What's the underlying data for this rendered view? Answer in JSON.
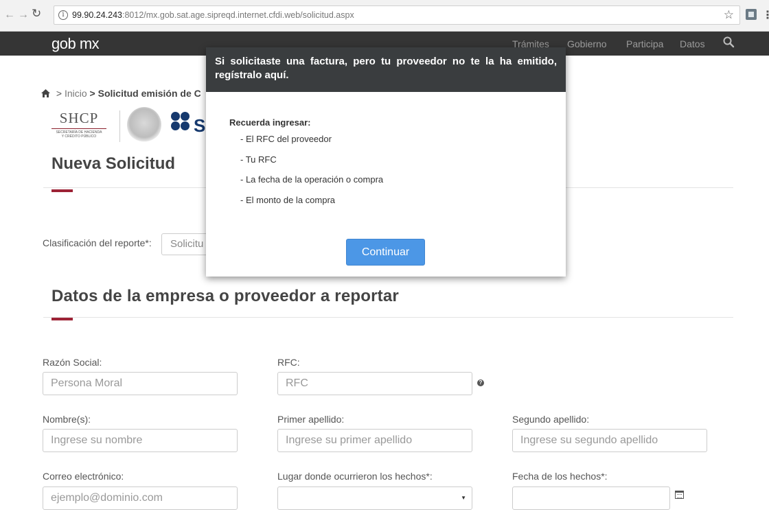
{
  "browser": {
    "url_host": "99.90.24.243",
    "url_rest": ":8012/mx.gob.sat.age.sipreqd.internet.cfdi.web/solicitud.aspx"
  },
  "topbar": {
    "logo": "gob mx",
    "nav": [
      "Trámites",
      "Gobierno",
      "Participa",
      "Datos"
    ]
  },
  "breadcrumb": {
    "home_sep": ">",
    "inicio": "Inicio",
    "current_sep": ">",
    "current": "Solicitud emisión de C"
  },
  "logos": {
    "shcp_title": "SHCP",
    "shcp_sub1": "SECRETARÍA DE HACIENDA",
    "shcp_sub2": "Y CRÉDITO PÚBLICO",
    "sat_letter": "S"
  },
  "page": {
    "nueva_solicitud": "Nueva Solicitud",
    "clasificacion_label": "Clasificación del reporte*:",
    "clasificacion_value": "Solicitu",
    "datos_heading": "Datos de la empresa o proveedor a reportar"
  },
  "form": {
    "razon_social_label": "Razón Social:",
    "razon_social_placeholder": "Persona Moral",
    "rfc_label": "RFC:",
    "rfc_placeholder": "RFC",
    "rfc_help": "?",
    "nombre_label": "Nombre(s):",
    "nombre_placeholder": "Ingrese su nombre",
    "primer_apellido_label": "Primer apellido:",
    "primer_apellido_placeholder": "Ingrese su primer apellido",
    "segundo_apellido_label": "Segundo apellido:",
    "segundo_apellido_placeholder": "Ingrese su segundo apellido",
    "correo_label": "Correo electrónico:",
    "correo_placeholder": "ejemplo@dominio.com",
    "lugar_label": "Lugar donde ocurrieron los hechos*:",
    "lugar_value": "",
    "lugar_caret": "▼",
    "fecha_label": "Fecha de los hechos*:",
    "fecha_value": ""
  },
  "modal": {
    "title": "Si solicitaste una factura, pero tu proveedor no te la ha emitido, regístralo aquí.",
    "intro": "Recuerda ingresar:",
    "items": [
      "- El RFC del proveedor",
      "- Tu RFC",
      "- La fecha de la operación o compra",
      "- El monto de la compra"
    ],
    "button": "Continuar"
  },
  "colors": {
    "topbar": "#353535",
    "accent": "#9d2235",
    "button": "#4c97e6",
    "modal_header": "#3a3d3f"
  }
}
